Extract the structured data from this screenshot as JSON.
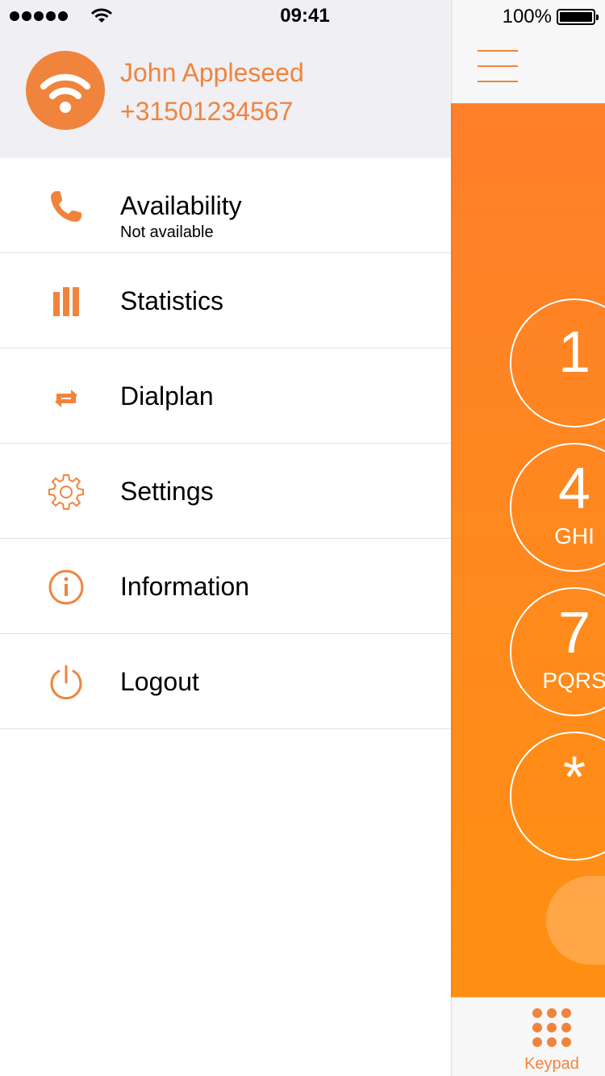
{
  "status_bar": {
    "time": "09:41",
    "battery": "100%"
  },
  "profile": {
    "name": "John Appleseed",
    "phone": "+31501234567"
  },
  "menu": {
    "items": [
      {
        "label": "Availability",
        "sublabel": "Not available",
        "icon": "phone-icon"
      },
      {
        "label": "Statistics",
        "icon": "bar-chart-icon"
      },
      {
        "label": "Dialplan",
        "icon": "swap-arrows-icon"
      },
      {
        "label": "Settings",
        "icon": "gear-icon"
      },
      {
        "label": "Information",
        "icon": "info-icon"
      },
      {
        "label": "Logout",
        "icon": "power-icon"
      }
    ]
  },
  "keypad": {
    "keys": [
      {
        "digit": "1",
        "letters": ""
      },
      {
        "digit": "4",
        "letters": "GHI"
      },
      {
        "digit": "7",
        "letters": "PQRS"
      },
      {
        "digit": "*",
        "letters": ""
      }
    ]
  },
  "tabbar": {
    "keypad_label": "Keypad"
  },
  "colors": {
    "accent": "#f0843d",
    "dialer_bg": "#ff8a1c",
    "header_bg": "#efeff4"
  }
}
